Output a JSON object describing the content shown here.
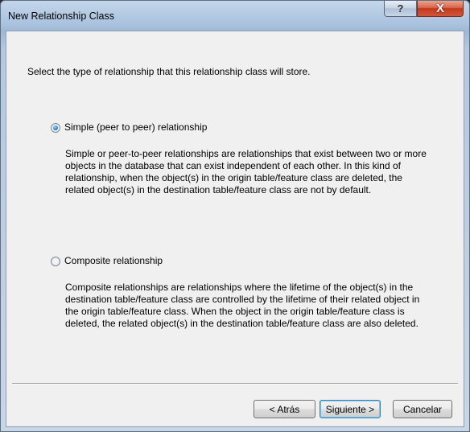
{
  "window": {
    "title": "New Relationship Class",
    "help_glyph": "?",
    "close_glyph": "X"
  },
  "prompt": "Select the type of relationship that this relationship class will store.",
  "options": [
    {
      "label": "Simple (peer to peer) relationship",
      "selected": true,
      "description": "Simple or peer-to-peer relationships are relationships that exist between two or more objects in the database that can exist independent of each other. In this kind of relationship, when the object(s) in the origin table/feature class are deleted, the related object(s) in the destination table/feature class are not by default."
    },
    {
      "label": "Composite relationship",
      "selected": false,
      "description": "Composite relationships are relationships where the lifetime of the object(s) in the destination table/feature class are controlled by the lifetime of their related object in the origin table/feature class. When the object in the origin table/feature class is deleted, the related object(s) in the destination table/feature class are also deleted."
    }
  ],
  "buttons": {
    "back": "< Atrás",
    "next": "Siguiente >",
    "cancel": "Cancelar"
  },
  "icons": {
    "help": "help-icon",
    "close": "close-icon",
    "radio_selected": "radio-selected-icon",
    "radio_unselected": "radio-unselected-icon"
  },
  "colors": {
    "close_button": "#c3391a",
    "radio_accent": "#2a7fd4",
    "dialog_background": "#f0f0f0",
    "default_button_border": "#3c7fb1"
  }
}
